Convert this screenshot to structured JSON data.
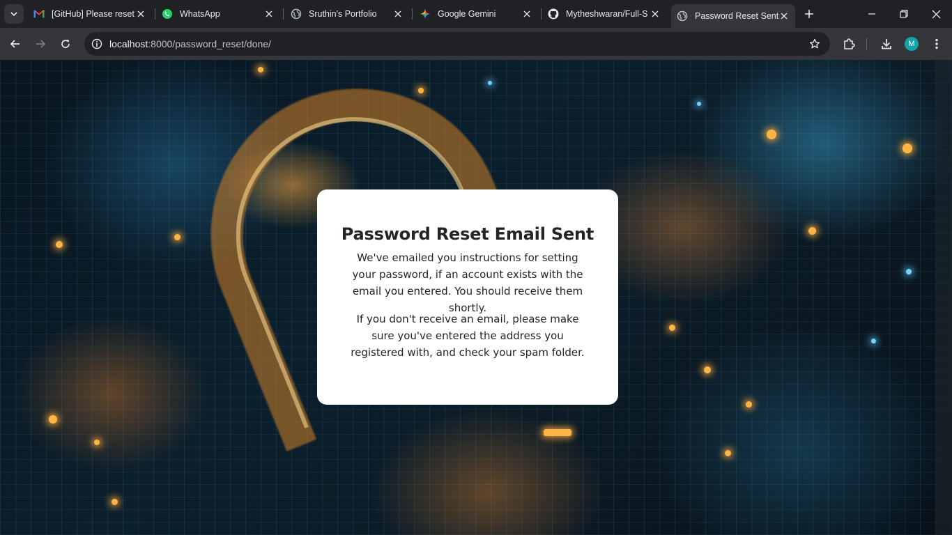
{
  "browser": {
    "tabs": [
      {
        "title": "[GitHub] Please reset",
        "icon": "gmail-icon"
      },
      {
        "title": "WhatsApp",
        "icon": "whatsapp-icon"
      },
      {
        "title": "Sruthin's Portfolio",
        "icon": "globe-icon"
      },
      {
        "title": "Google Gemini",
        "icon": "gemini-icon"
      },
      {
        "title": "Mytheshwaran/Full-S",
        "icon": "github-icon"
      },
      {
        "title": "Password Reset Sent",
        "icon": "globe-icon",
        "active": true
      }
    ],
    "url_host": "localhost",
    "url_rest": ":8000/password_reset/done/",
    "profile_initial": "M",
    "colors": {
      "tabstrip": "#202124",
      "toolbar": "#35363a",
      "avatar": "#12a4a8"
    }
  },
  "page": {
    "heading": "Password Reset Email Sent",
    "paragraph1": "We've emailed you instructions for setting your password, if an account exists with the email you entered. You should receive them shortly.",
    "paragraph2": "If you don't receive an email, please make sure you've entered the address you registered with, and check your spam folder."
  }
}
